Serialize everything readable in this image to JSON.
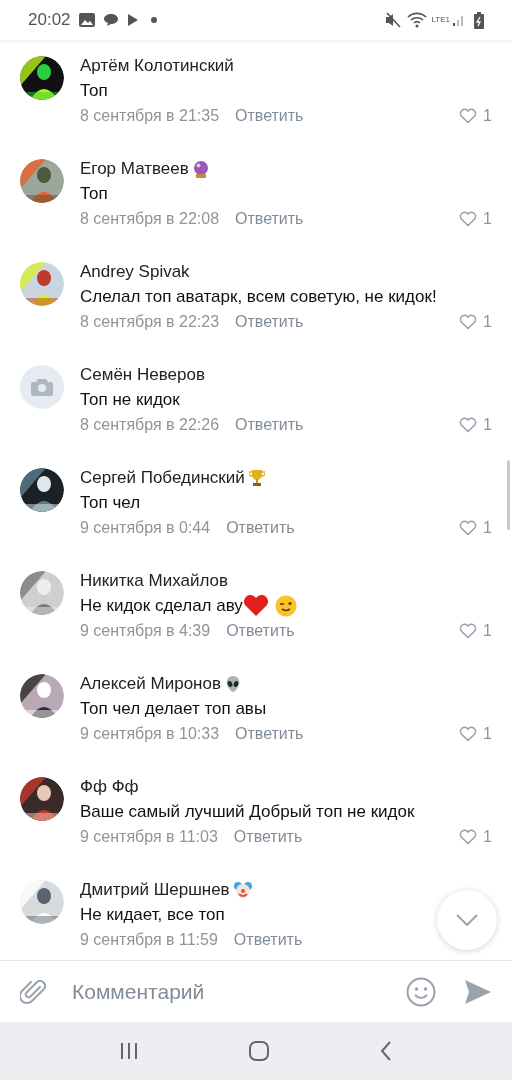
{
  "status_bar": {
    "time": "20:02",
    "network": "LTE1"
  },
  "comments": [
    {
      "author": "Артём Колотинский",
      "text": "Топ",
      "date": "8 сентября в 21:35",
      "reply": "Ответить",
      "likes": "1"
    },
    {
      "author": "Егор Матвеев",
      "badge": {
        "kind": "orb"
      },
      "text": "Топ",
      "date": "8 сентября в 22:08",
      "reply": "Ответить",
      "likes": "1"
    },
    {
      "author": "Andrey Spivak",
      "text": "Слелал топ аватарк, всем советую, не кидок!",
      "date": "8 сентября в 22:23",
      "reply": "Ответить",
      "likes": "1"
    },
    {
      "author": "Семён Неверов",
      "avatar": {
        "kind": "placeholder"
      },
      "text": "Топ не кидок",
      "date": "8 сентября в 22:26",
      "reply": "Ответить",
      "likes": "1"
    },
    {
      "author": "Сергей Побединский",
      "badge": {
        "kind": "trophy"
      },
      "text": "Топ чел",
      "date": "9 сентября в 0:44",
      "reply": "Ответить",
      "likes": "1"
    },
    {
      "author": "Никитка Михайлов",
      "text": "Не кидок сделал аву",
      "emoji": [
        {
          "kind": "heart"
        },
        {
          "kind": "wink"
        }
      ],
      "date": "9 сентября в 4:39",
      "reply": "Ответить",
      "likes": "1"
    },
    {
      "author": "Алексей Миронов",
      "badge": {
        "kind": "alien"
      },
      "text": "Топ чел делает топ авы",
      "date": "9 сентября в 10:33",
      "reply": "Ответить",
      "likes": "1"
    },
    {
      "author": "Фф Фф",
      "text": "Ваше самый лучший Добрый топ не кидок",
      "date": "9 сентября в 11:03",
      "reply": "Ответить",
      "likes": "1"
    },
    {
      "author": "Дмитрий Шершнев",
      "badge": {
        "kind": "clown"
      },
      "text": "Не кидает, все топ",
      "date": "9 сентября в 11:59",
      "reply": "Ответить"
    }
  ],
  "composer": {
    "placeholder": "Комментарий"
  }
}
